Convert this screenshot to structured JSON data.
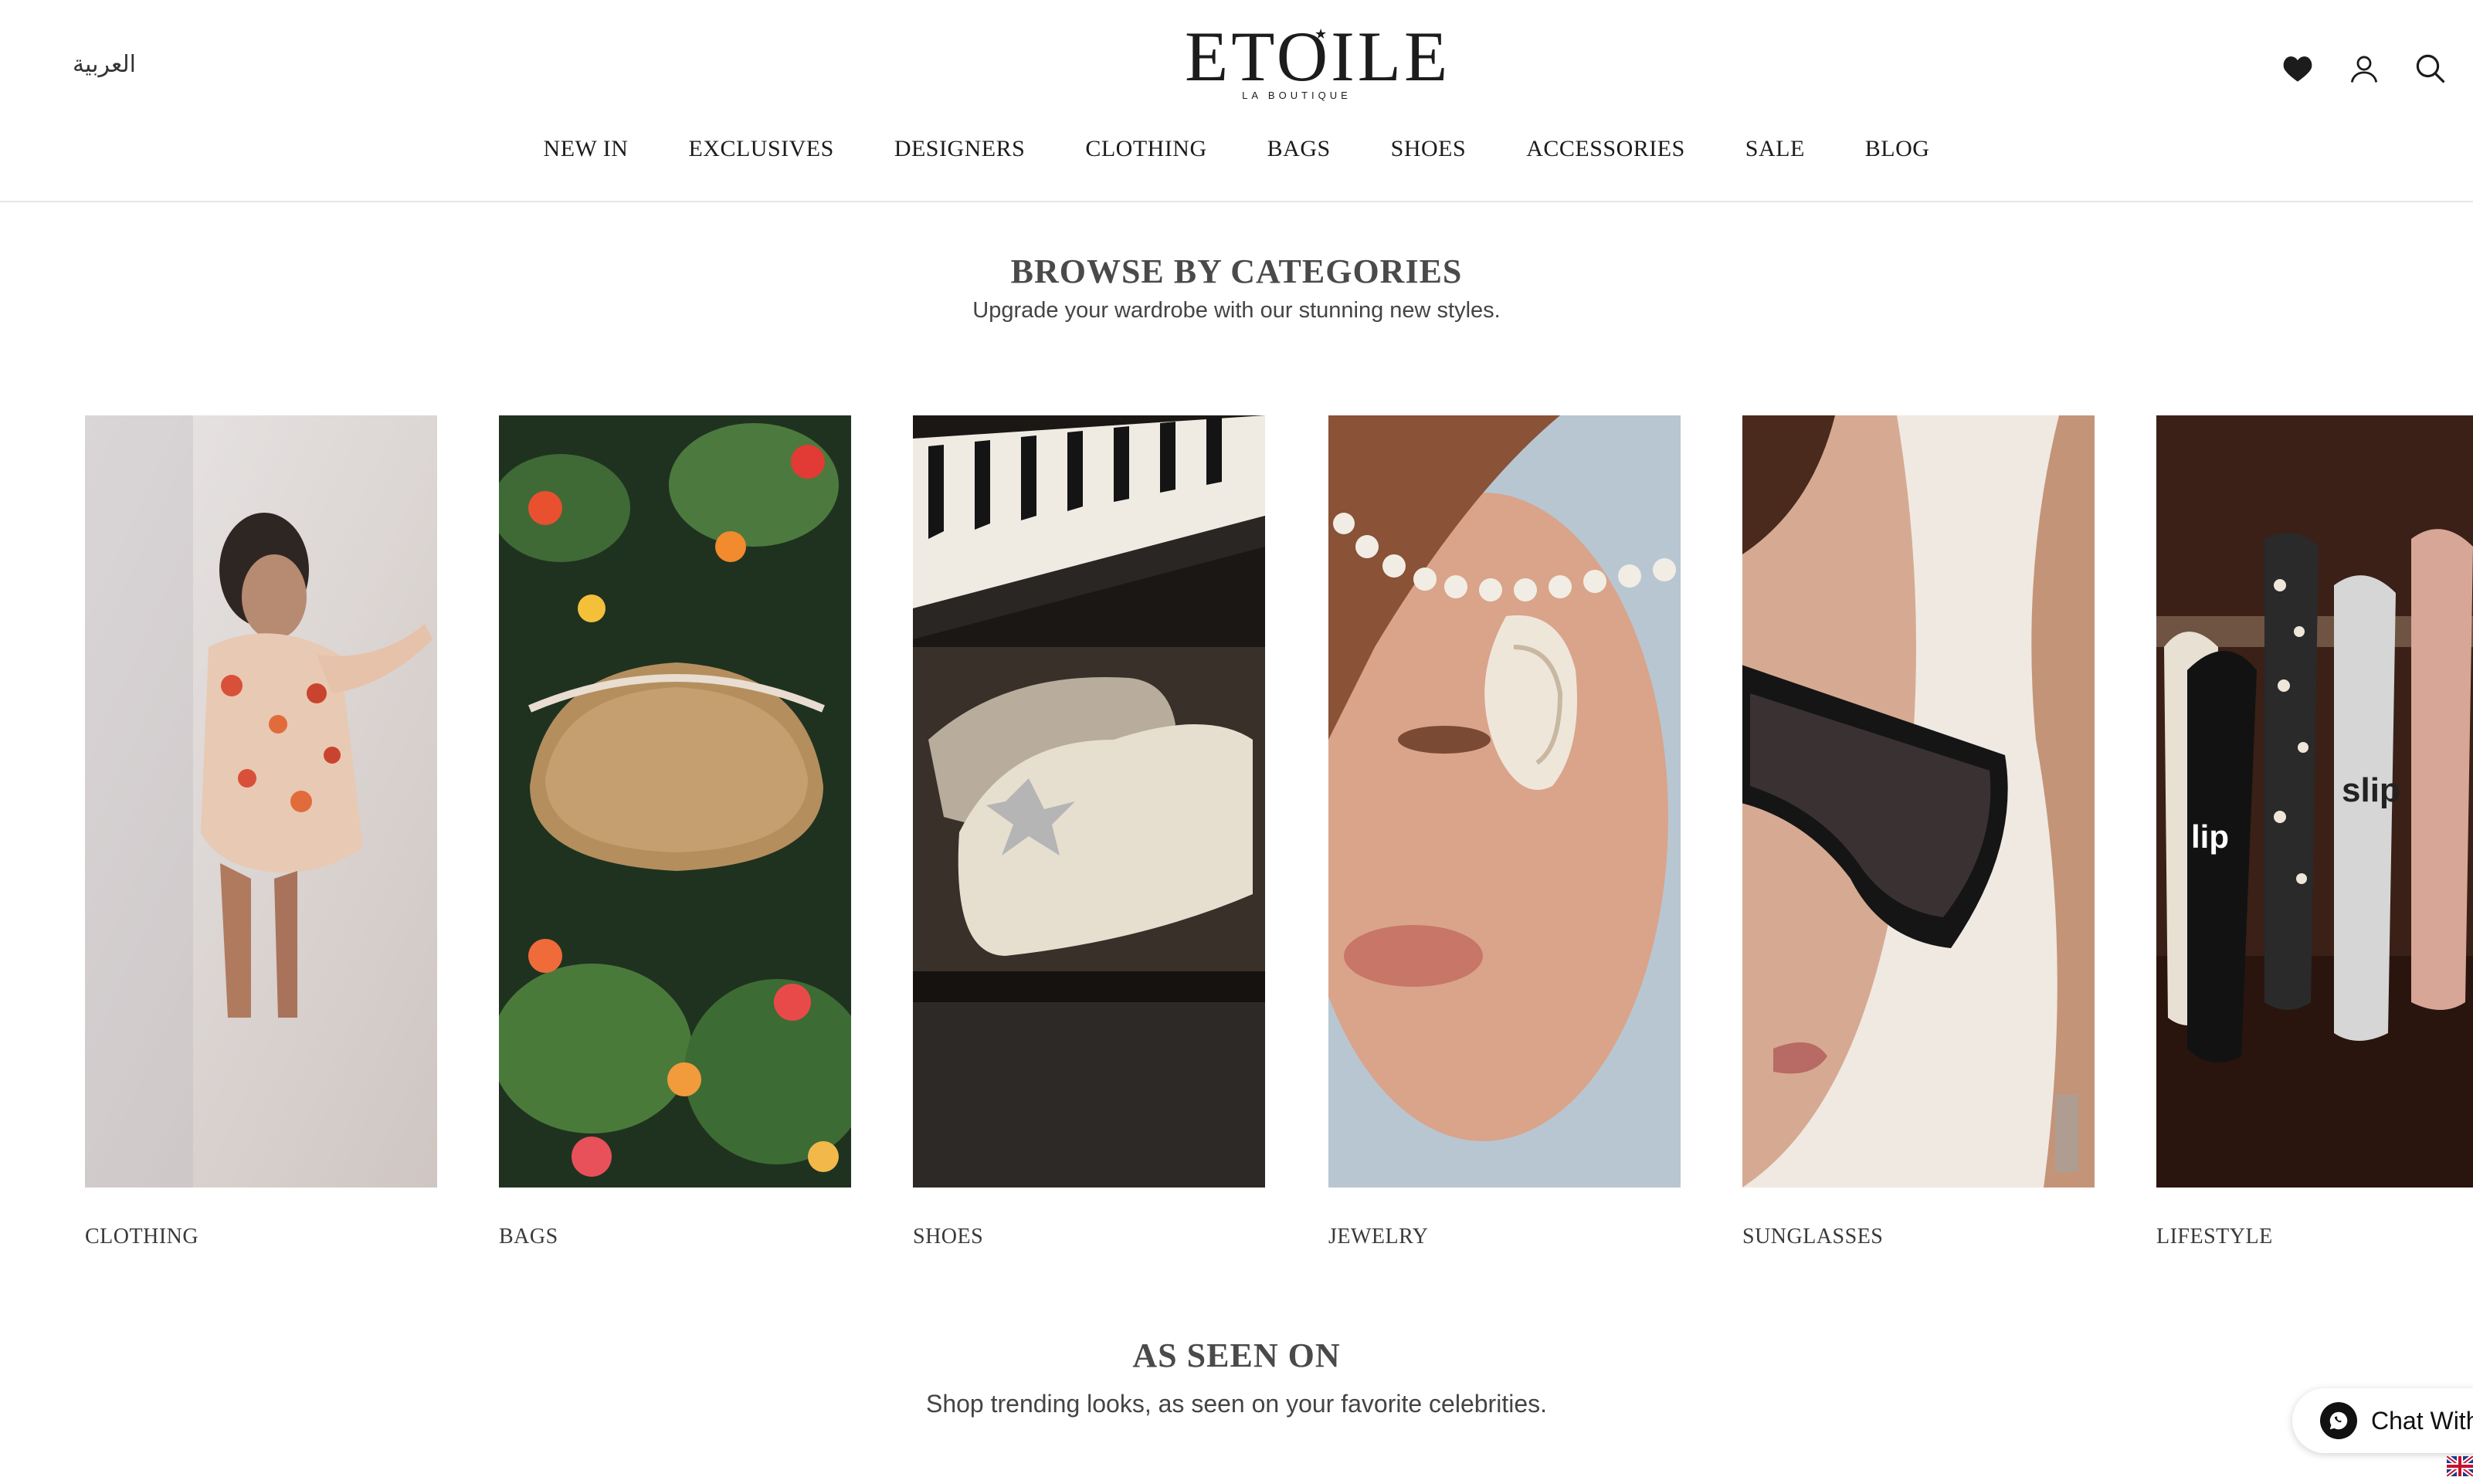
{
  "header": {
    "language_link": "العربية",
    "logo": {
      "name": "ETOILE",
      "subtitle": "LA BOUTIQUE"
    },
    "icons": [
      "heart-icon",
      "account-icon",
      "search-icon"
    ]
  },
  "nav": {
    "items": [
      "NEW IN",
      "EXCLUSIVES",
      "DESIGNERS",
      "CLOTHING",
      "BAGS",
      "SHOES",
      "ACCESSORIES",
      "SALE",
      "BLOG"
    ]
  },
  "browse": {
    "title": "BROWSE BY CATEGORIES",
    "subtitle": "Upgrade your wardrobe with our stunning new styles.",
    "categories": [
      {
        "label": "CLOTHING"
      },
      {
        "label": "BAGS"
      },
      {
        "label": "SHOES"
      },
      {
        "label": "JEWELRY"
      },
      {
        "label": "SUNGLASSES"
      },
      {
        "label": "LIFESTYLE"
      }
    ]
  },
  "seen_on": {
    "title": "AS SEEN ON",
    "subtitle": "Shop trending looks, as seen on your favorite celebrities."
  },
  "chat": {
    "label": "Chat With",
    "icon": "whatsapp-icon"
  },
  "locale_flag": "uk-flag-icon"
}
